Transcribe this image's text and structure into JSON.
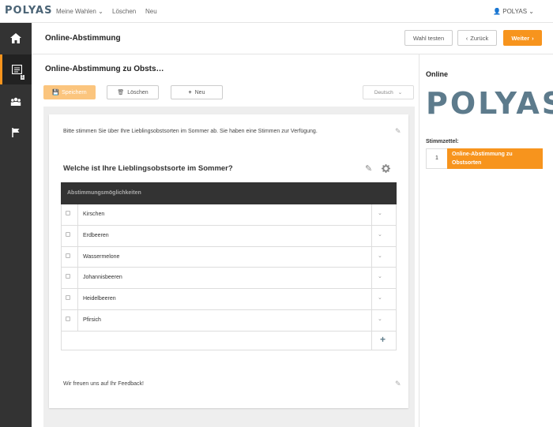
{
  "topnav": {
    "logo": "POLYAS",
    "items": [
      "Meine Wahlen",
      "Löschen",
      "Neu"
    ],
    "user": "POLYAS"
  },
  "header": {
    "title": "Online-Abstimmung",
    "test_label": "Wahl testen",
    "back_label": "Zurück",
    "next_label": "Weiter"
  },
  "main": {
    "subtitle": "Online-Abstimmung zu Obsts…",
    "save_label": "Speichern",
    "delete_label": "Löschen",
    "new_label": "Neu",
    "language": "Deutsch",
    "intro": "Bitte stimmen Sie über Ihre Lieblingsobstsorten im Sommer ab. Sie haben eine Stimmen zur Verfügung.",
    "question": "Welche ist Ihre Lieblingsobstsorte im Sommer?",
    "options_header": "Abstimmungsmöglichkeiten",
    "options": [
      "Kirschen",
      "Erdbeeren",
      "Wassermelone",
      "Johannisbeeren",
      "Heidelbeeren",
      "Pfirsich"
    ],
    "feedback": "Wir freuen uns auf Ihr Feedback!"
  },
  "right": {
    "status": "Online",
    "logo": "POLYAS",
    "ballot_label": "Stimmzettel:",
    "ballot_number": "1",
    "ballot_name": "Online-Abstimmung zu Obstsorten"
  },
  "colors": {
    "accent": "#f7941d",
    "sidebar": "#333333",
    "logo": "#5d7b8c"
  }
}
